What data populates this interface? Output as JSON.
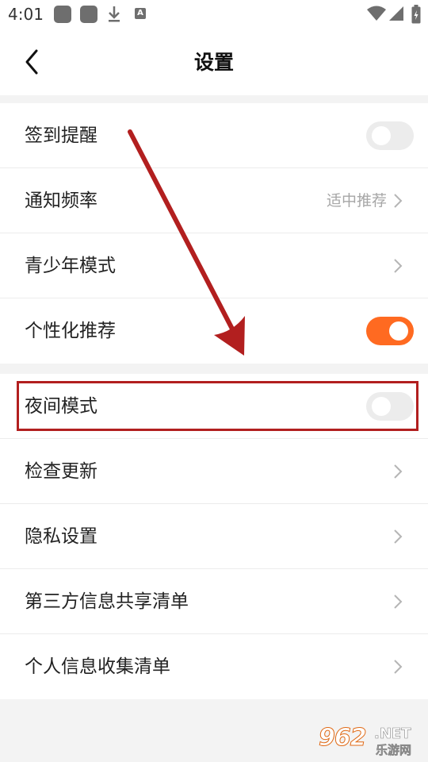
{
  "status_bar": {
    "time": "4:01",
    "a_badge": "A"
  },
  "nav": {
    "title": "设置"
  },
  "section1": {
    "items": [
      {
        "label": "签到提醒",
        "control": "toggle",
        "on": false
      },
      {
        "label": "通知频率",
        "control": "chevron",
        "value": "适中推荐"
      },
      {
        "label": "青少年模式",
        "control": "chevron"
      },
      {
        "label": "个性化推荐",
        "control": "toggle",
        "on": true
      }
    ]
  },
  "section2": {
    "items": [
      {
        "label": "夜间模式",
        "control": "toggle",
        "on": false
      },
      {
        "label": "检查更新",
        "control": "chevron"
      },
      {
        "label": "隐私设置",
        "control": "chevron"
      },
      {
        "label": "第三方信息共享清单",
        "control": "chevron"
      },
      {
        "label": "个人信息收集清单",
        "control": "chevron"
      }
    ]
  },
  "colors": {
    "accent": "#ff6a21",
    "annotation": "#b21f1f",
    "toggle_off": "#ececec"
  },
  "watermark": {
    "brand_number": "962",
    "brand_suffix": ".NET",
    "brand_cn": "乐游网"
  }
}
